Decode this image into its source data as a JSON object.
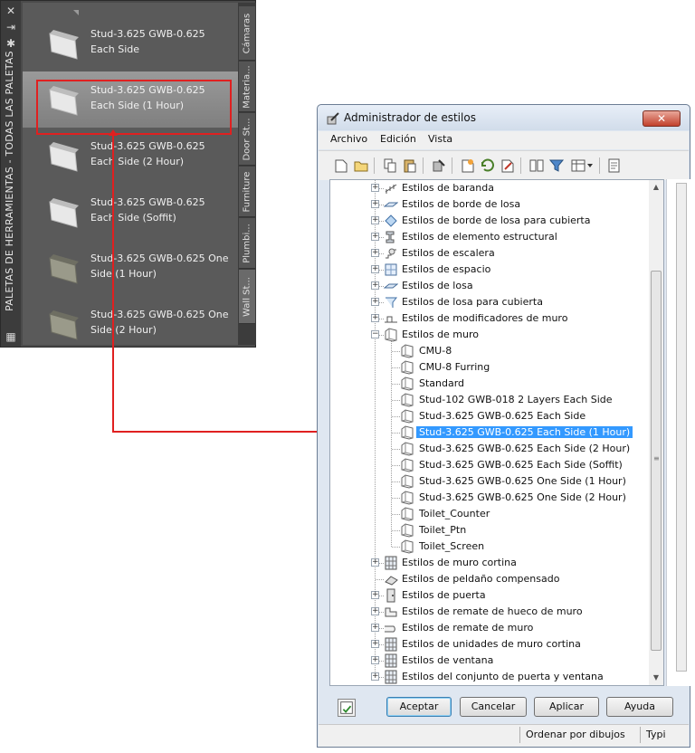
{
  "palette": {
    "title": "PALETAS DE HERRAMIENTAS - TODAS LAS PALETAS",
    "items": [
      {
        "label": "Stud-3.625 GWB-0.625\nEach Side",
        "selected": false
      },
      {
        "label": "Stud-3.625 GWB-0.625\nEach Side (1 Hour)",
        "selected": true
      },
      {
        "label": "Stud-3.625 GWB-0.625\nEach Side (2 Hour)",
        "selected": false
      },
      {
        "label": "Stud-3.625 GWB-0.625\nEach Side (Soffit)",
        "selected": false
      },
      {
        "label": "Stud-3.625 GWB-0.625 One\nSide (1 Hour)",
        "selected": false
      },
      {
        "label": "Stud-3.625 GWB-0.625 One\nSide (2 Hour)",
        "selected": false
      }
    ],
    "tabs": [
      "Cámaras",
      "Materia...",
      "Door St...",
      "Furniture",
      "Plumbi...",
      "Wall St..."
    ]
  },
  "window": {
    "title": "Administrador de estilos",
    "close_label": "✕",
    "menu": [
      "Archivo",
      "Edición",
      "Vista"
    ],
    "tree": [
      {
        "label": "Estilos de baranda",
        "level": 0,
        "expander": "+",
        "icon": "railing-icon"
      },
      {
        "label": "Estilos de borde de losa",
        "level": 0,
        "expander": "+",
        "icon": "slab-edge-icon"
      },
      {
        "label": "Estilos de borde de losa para cubierta",
        "level": 0,
        "expander": "+",
        "icon": "roof-slab-edge-icon"
      },
      {
        "label": "Estilos de elemento estructural",
        "level": 0,
        "expander": "+",
        "icon": "structural-member-icon"
      },
      {
        "label": "Estilos de escalera",
        "level": 0,
        "expander": "+",
        "icon": "stair-icon"
      },
      {
        "label": "Estilos de espacio",
        "level": 0,
        "expander": "+",
        "icon": "space-icon"
      },
      {
        "label": "Estilos de losa",
        "level": 0,
        "expander": "+",
        "icon": "slab-icon"
      },
      {
        "label": "Estilos de losa para cubierta",
        "level": 0,
        "expander": "+",
        "icon": "roof-slab-icon"
      },
      {
        "label": "Estilos de modificadores de muro",
        "level": 0,
        "expander": "+",
        "icon": "wall-modifier-icon"
      },
      {
        "label": "Estilos de muro",
        "level": 0,
        "expander": "−",
        "icon": "wall-style-icon"
      },
      {
        "label": "CMU-8",
        "level": 1,
        "expander": "",
        "icon": "wall-style-icon"
      },
      {
        "label": "CMU-8 Furring",
        "level": 1,
        "expander": "",
        "icon": "wall-style-icon"
      },
      {
        "label": "Standard",
        "level": 1,
        "expander": "",
        "icon": "wall-style-icon"
      },
      {
        "label": "Stud-102 GWB-018 2 Layers Each Side",
        "level": 1,
        "expander": "",
        "icon": "wall-style-icon"
      },
      {
        "label": "Stud-3.625 GWB-0.625 Each Side",
        "level": 1,
        "expander": "",
        "icon": "wall-style-icon"
      },
      {
        "label": "Stud-3.625 GWB-0.625 Each Side (1 Hour)",
        "level": 1,
        "expander": "",
        "icon": "wall-style-icon",
        "selected": true
      },
      {
        "label": "Stud-3.625 GWB-0.625 Each Side (2 Hour)",
        "level": 1,
        "expander": "",
        "icon": "wall-style-icon"
      },
      {
        "label": "Stud-3.625 GWB-0.625 Each Side (Soffit)",
        "level": 1,
        "expander": "",
        "icon": "wall-style-icon"
      },
      {
        "label": "Stud-3.625 GWB-0.625 One Side (1 Hour)",
        "level": 1,
        "expander": "",
        "icon": "wall-style-icon"
      },
      {
        "label": "Stud-3.625 GWB-0.625 One Side (2 Hour)",
        "level": 1,
        "expander": "",
        "icon": "wall-style-icon"
      },
      {
        "label": "Toilet_Counter",
        "level": 1,
        "expander": "",
        "icon": "wall-style-icon"
      },
      {
        "label": "Toilet_Ptn",
        "level": 1,
        "expander": "",
        "icon": "wall-style-icon"
      },
      {
        "label": "Toilet_Screen",
        "level": 1,
        "expander": "",
        "icon": "wall-style-icon"
      },
      {
        "label": "Estilos de muro cortina",
        "level": 0,
        "expander": "+",
        "icon": "curtain-wall-icon"
      },
      {
        "label": "Estilos de peldaño compensado",
        "level": 0,
        "expander": "",
        "icon": "winder-icon"
      },
      {
        "label": "Estilos de puerta",
        "level": 0,
        "expander": "+",
        "icon": "door-icon"
      },
      {
        "label": "Estilos de remate de hueco de muro",
        "level": 0,
        "expander": "+",
        "icon": "opening-endcap-icon"
      },
      {
        "label": "Estilos de remate de muro",
        "level": 0,
        "expander": "+",
        "icon": "wall-endcap-icon"
      },
      {
        "label": "Estilos de unidades de muro cortina",
        "level": 0,
        "expander": "+",
        "icon": "curtain-wall-unit-icon"
      },
      {
        "label": "Estilos de ventana",
        "level": 0,
        "expander": "+",
        "icon": "window-icon"
      },
      {
        "label": "Estilos del conjunto de puerta y ventana",
        "level": 0,
        "expander": "+",
        "icon": "door-window-assembly-icon"
      }
    ],
    "buttons": {
      "ok": "Aceptar",
      "cancel": "Cancelar",
      "apply": "Aplicar",
      "help": "Ayuda"
    },
    "status": {
      "sort": "Ordenar por dibujos",
      "type": "Typi"
    }
  },
  "colors": {
    "highlight": "#e02020",
    "selection": "#3399ff",
    "palette_bg": "#5a5a5a"
  }
}
